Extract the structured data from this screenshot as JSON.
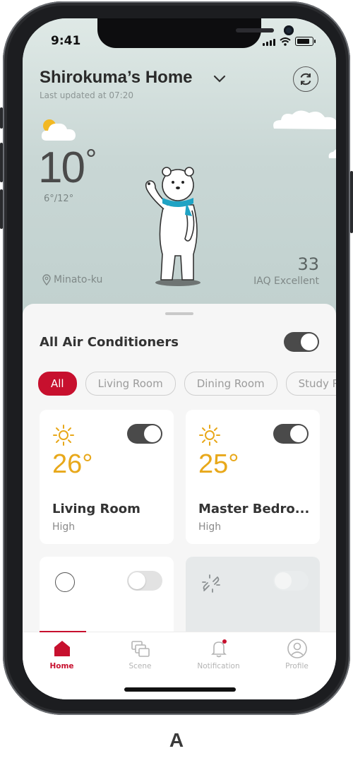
{
  "status_bar": {
    "time": "9:41"
  },
  "header": {
    "home_name": "Shirokuma’s Home",
    "last_updated": "Last updated at 07:20"
  },
  "weather": {
    "icon": "partly-cloudy-icon",
    "temperature": "10",
    "degree_symbol": "°",
    "range": "6°/12°",
    "location": "Minato-ku",
    "iaq_value": "33",
    "iaq_label": "IAQ Excellent"
  },
  "panel": {
    "title": "All Air Conditioners",
    "all_on": true,
    "filters": [
      {
        "label": "All",
        "active": true
      },
      {
        "label": "Living Room",
        "active": false
      },
      {
        "label": "Dining Room",
        "active": false
      },
      {
        "label": "Study Room",
        "active": false
      }
    ]
  },
  "devices": [
    {
      "name": "Living Room",
      "temperature": "26°",
      "mode": "High",
      "icon": "sun-icon",
      "on": true
    },
    {
      "name": "Master Bedro...",
      "temperature": "25°",
      "mode": "High",
      "icon": "sun-icon",
      "on": true
    },
    {
      "name": "",
      "temperature": "",
      "mode": "",
      "icon": "circle-icon",
      "on": false
    },
    {
      "name": "",
      "temperature": "",
      "mode": "",
      "icon": "broken-link-icon",
      "on": false,
      "disabled": true
    }
  ],
  "tabs": [
    {
      "label": "Home",
      "icon": "home-icon",
      "active": true
    },
    {
      "label": "Scene",
      "icon": "scene-icon",
      "active": false
    },
    {
      "label": "Notification",
      "icon": "bell-icon",
      "active": false,
      "badge": true
    },
    {
      "label": "Profile",
      "icon": "user-icon",
      "active": false
    }
  ],
  "caption": "A",
  "colors": {
    "accent": "#c7102e",
    "sun": "#e8a81a",
    "toggle_on": "#4a4a4a",
    "scarf": "#1fa3c4"
  }
}
